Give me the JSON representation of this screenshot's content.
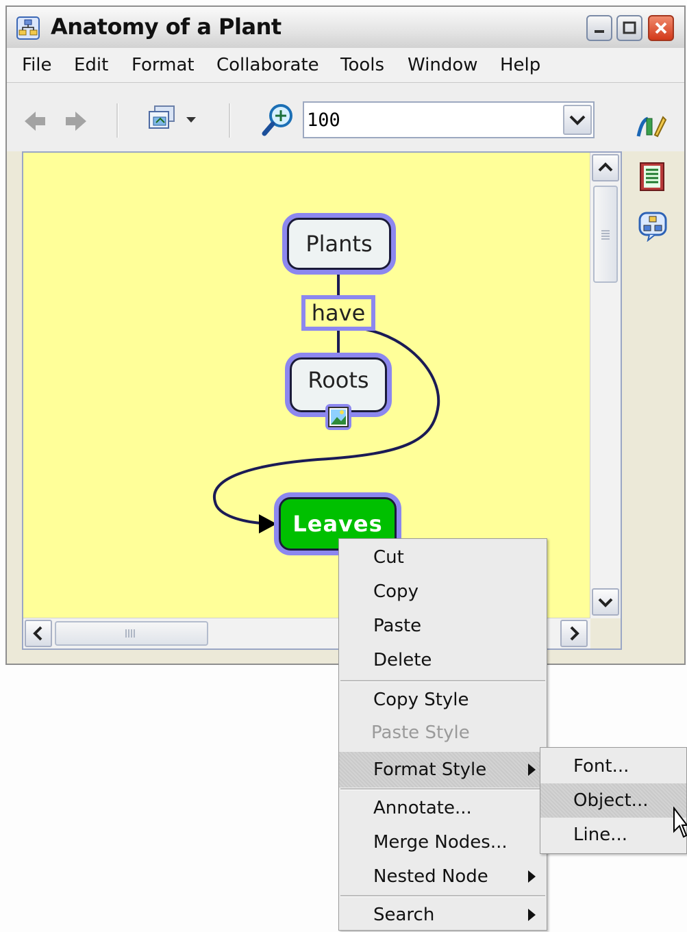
{
  "window": {
    "title": "Anatomy of a Plant"
  },
  "menubar": {
    "items": [
      "File",
      "Edit",
      "Format",
      "Collaborate",
      "Tools",
      "Window",
      "Help"
    ]
  },
  "toolbar": {
    "zoom_value": "100"
  },
  "map": {
    "nodes": {
      "plants": "Plants",
      "roots": "Roots",
      "leaves": "Leaves"
    },
    "link_label": "have",
    "colors": {
      "background": "#ffff99",
      "node_border": "#8c87ef",
      "leaves_fill": "#00c000",
      "node_fill": "#eef3f3"
    }
  },
  "context_menu": {
    "items": {
      "cut": "Cut",
      "copy": "Copy",
      "paste": "Paste",
      "delete": "Delete",
      "copy_style": "Copy Style",
      "paste_style": "Paste Style",
      "format_style": "Format Style",
      "annotate": "Annotate...",
      "merge_nodes": "Merge Nodes...",
      "nested_node": "Nested Node",
      "search": "Search"
    },
    "highlighted": "Format Style",
    "disabled": [
      "Paste Style"
    ]
  },
  "submenu": {
    "items": {
      "font": "Font...",
      "object": "Object...",
      "line": "Line..."
    },
    "highlighted": "Object..."
  },
  "icons": {
    "app": "concept-map-icon",
    "back": "back-arrow-icon",
    "forward": "forward-arrow-icon",
    "view": "view-mode-icon",
    "zoom": "zoom-in-icon",
    "styles": "styles-palette-icon",
    "notes": "notes-icon",
    "collab": "collaboration-icon",
    "image": "image-resource-icon",
    "cursor": "mouse-cursor-icon"
  }
}
